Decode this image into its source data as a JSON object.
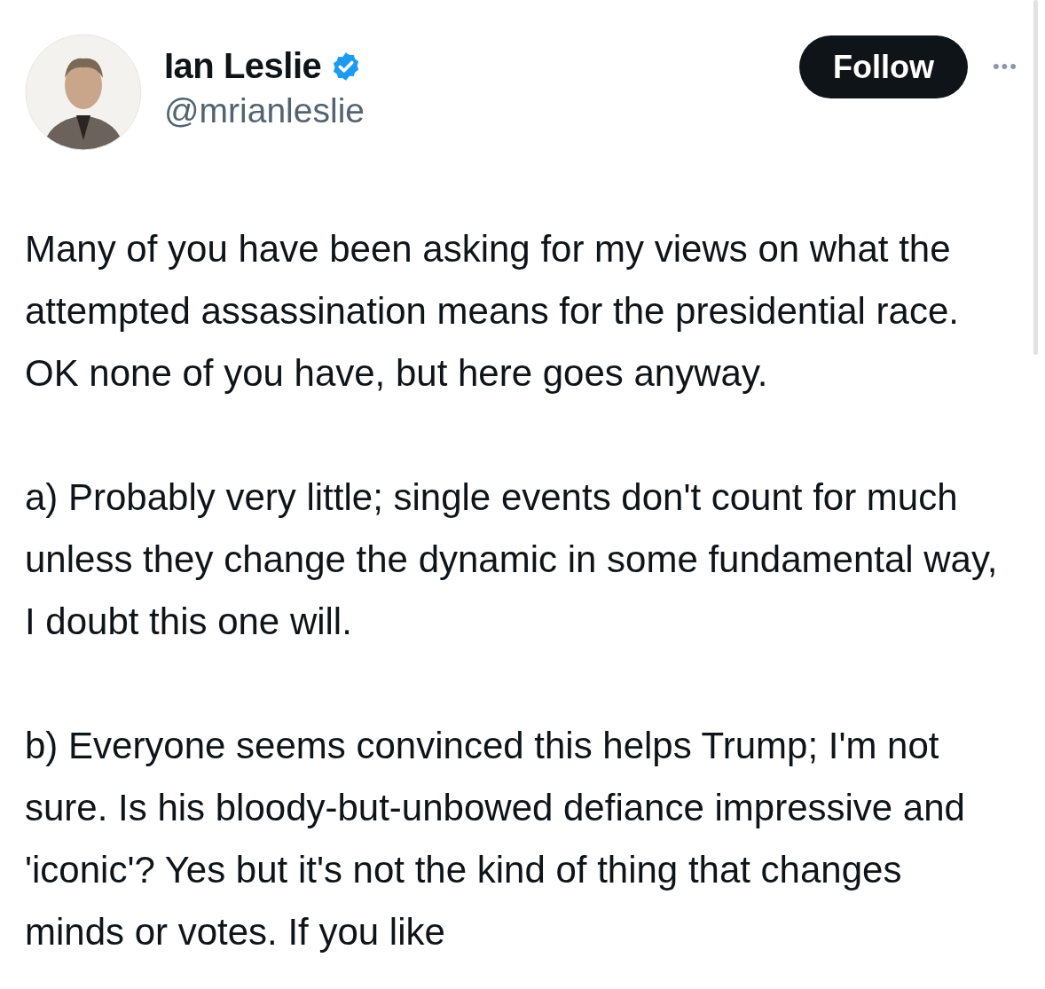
{
  "author": {
    "name": "Ian Leslie",
    "verified": true,
    "handle": "@mrianleslie"
  },
  "follow_button": {
    "label": "Follow"
  },
  "more_button": {
    "label": "•••"
  },
  "tweet": {
    "paragraphs": [
      "Many of you have been asking for my views on what the attempted assassination means for the presidential race. OK none of you have, but here goes anyway.",
      "a) Probably very little; single events don't count for much unless they change the dynamic in some fundamental way, I doubt this one will.",
      "b) Everyone seems convinced this helps Trump; I'm not sure. Is his bloody-but-unbowed defiance impressive and 'iconic'? Yes but it's not the kind of thing that changes minds or votes. If you like"
    ]
  }
}
